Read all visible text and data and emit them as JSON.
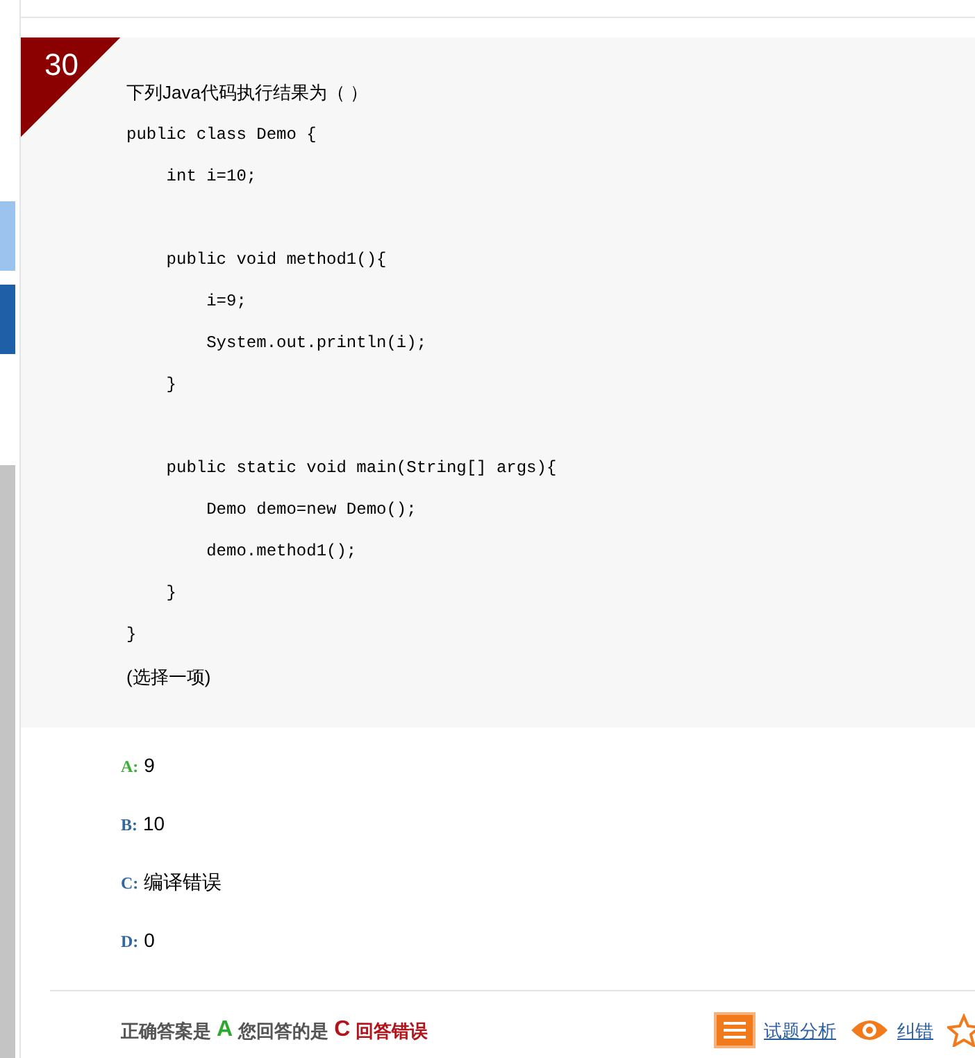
{
  "question": {
    "number": "30",
    "prompt": "下列Java代码执行结果为（ ）",
    "code": "public class Demo {\n    int i=10;\n\n    public void method1(){\n        i=9;\n        System.out.println(i);\n    }\n\n    public static void main(String[] args){\n        Demo demo=new Demo();\n        demo.method1();\n    }\n}",
    "hint": "(选择一项)"
  },
  "options": [
    {
      "letter": "A:",
      "text": "9",
      "correct": true
    },
    {
      "letter": "B:",
      "text": "10",
      "correct": false
    },
    {
      "letter": "C:",
      "text": "编译错误",
      "correct": false
    },
    {
      "letter": "D:",
      "text": "0",
      "correct": false
    }
  ],
  "result": {
    "correct_label": "正确答案是",
    "correct_answer": "A",
    "your_label": "您回答的是",
    "your_answer": "C",
    "verdict": "回答错误"
  },
  "links": [
    {
      "kind": "analysis",
      "label": "试题分析"
    },
    {
      "kind": "report",
      "label": "纠错"
    },
    {
      "kind": "favorite"
    }
  ]
}
